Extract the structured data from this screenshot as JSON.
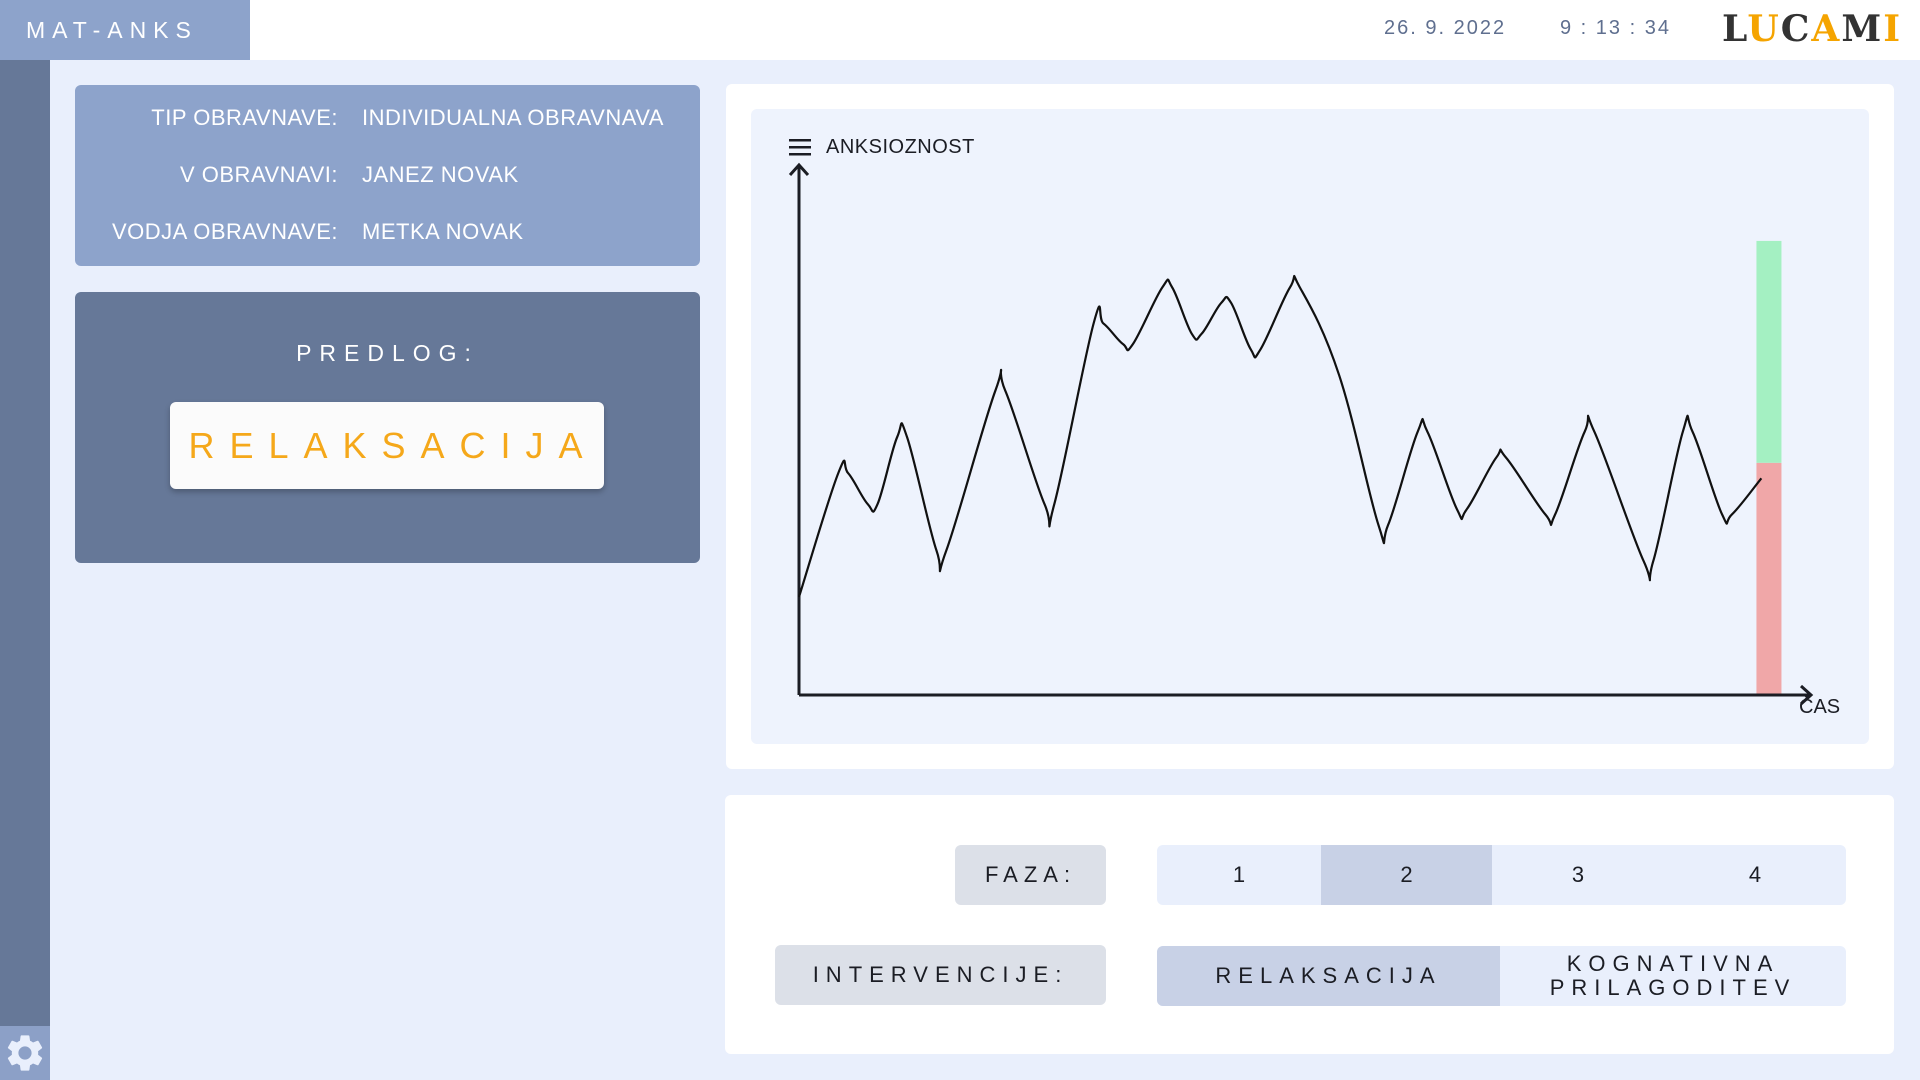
{
  "header": {
    "app_title": "MAT-ANKS",
    "date": "26. 9. 2022",
    "time": "9 : 13 : 34",
    "logo": "LUCAMI",
    "logo_accent_color": "#f5a400"
  },
  "sidebar": {
    "settings_icon": "gear-icon"
  },
  "session_info": {
    "rows": [
      {
        "label": "TIP OBRAVNAVE:",
        "value": "INDIVIDUALNA OBRAVNAVA"
      },
      {
        "label": "V OBRAVNAVI:",
        "value": "JANEZ NOVAK"
      },
      {
        "label": "VODJA OBRAVNAVE:",
        "value": "METKA NOVAK"
      }
    ]
  },
  "suggestion": {
    "label": "PREDLOG:",
    "value": "RELAKSACIJA",
    "value_color": "#f5a81a"
  },
  "chart_data": {
    "type": "line",
    "ylabel": "ANKSIOZNOST",
    "xlabel": "ČAS",
    "menu_icon": "hamburger-menu-icon",
    "grid": false,
    "y_range": [
      0,
      100
    ],
    "x_range": [
      0,
      100
    ],
    "series": [
      {
        "points": [
          [
            0,
            19
          ],
          [
            4,
            43
          ],
          [
            5,
            43
          ],
          [
            7,
            37
          ],
          [
            8,
            37
          ],
          [
            10,
            50
          ],
          [
            11,
            50
          ],
          [
            14,
            28
          ],
          [
            15,
            28
          ],
          [
            20,
            59
          ],
          [
            21,
            59
          ],
          [
            25,
            37
          ],
          [
            26,
            37
          ],
          [
            30,
            72
          ],
          [
            31,
            72
          ],
          [
            33,
            68
          ],
          [
            34,
            68
          ],
          [
            37,
            79
          ],
          [
            38,
            79
          ],
          [
            40,
            70
          ],
          [
            41,
            70
          ],
          [
            43,
            76
          ],
          [
            44,
            76
          ],
          [
            46,
            67
          ],
          [
            47,
            67
          ],
          [
            50,
            79
          ],
          [
            51,
            79
          ],
          [
            55,
            62
          ],
          [
            59,
            33
          ],
          [
            60,
            33
          ],
          [
            63,
            51
          ],
          [
            64,
            51
          ],
          [
            67,
            36
          ],
          [
            68,
            36
          ],
          [
            71,
            46
          ],
          [
            72,
            46
          ],
          [
            76,
            35
          ],
          [
            77,
            35
          ],
          [
            80,
            51
          ],
          [
            81,
            51
          ],
          [
            86,
            26
          ],
          [
            87,
            26
          ],
          [
            90,
            51
          ],
          [
            91,
            51
          ],
          [
            94,
            35
          ],
          [
            95,
            35
          ],
          [
            98,
            42
          ]
        ]
      }
    ],
    "indicator_bar": {
      "green_range": [
        45,
        88
      ],
      "red_range": [
        0,
        45
      ],
      "green_color": "#a4f0c2",
      "red_color": "#f0a7a8"
    }
  },
  "controls": {
    "phase_label": "FAZA:",
    "phases": [
      "1",
      "2",
      "3",
      "4"
    ],
    "active_phase": "2",
    "interventions_label": "INTERVENCIJE:",
    "interventions": [
      "RELAKSACIJA",
      "KOGNATIVNA PRILAGODITEV"
    ],
    "active_intervention": "RELAKSACIJA"
  }
}
